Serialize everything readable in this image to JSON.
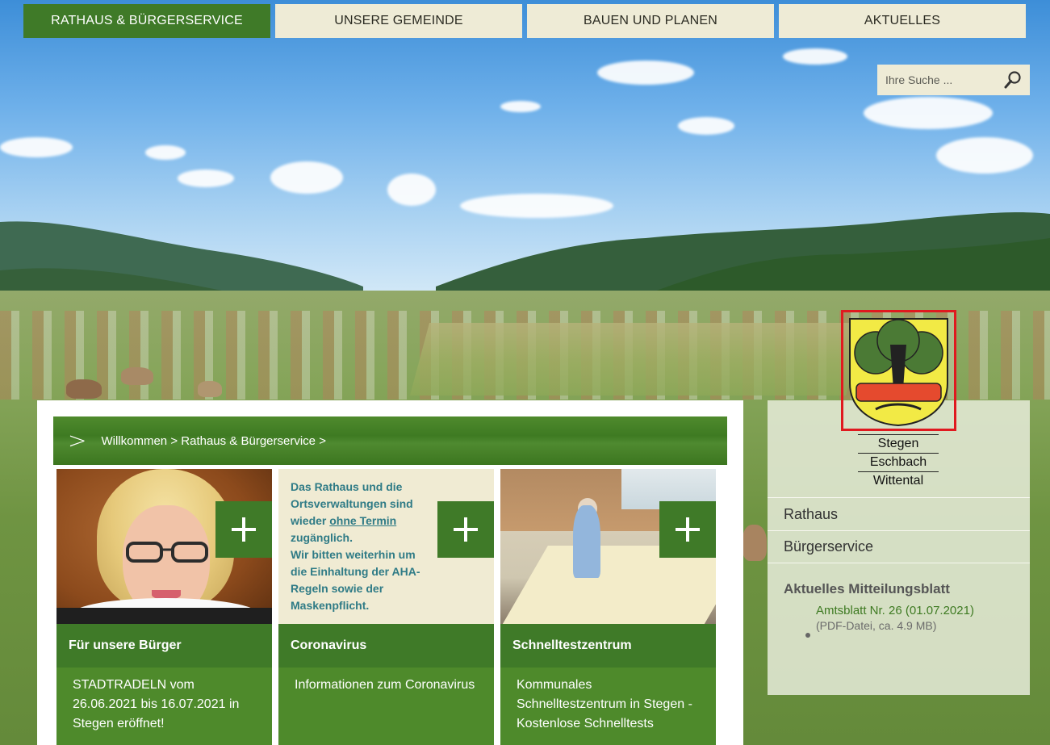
{
  "nav": {
    "items": [
      {
        "label": "RATHAUS & BÜRGERSERVICE",
        "active": true
      },
      {
        "label": "UNSERE GEMEINDE",
        "active": false
      },
      {
        "label": "BAUEN UND PLANEN",
        "active": false
      },
      {
        "label": "AKTUELLES",
        "active": false
      }
    ]
  },
  "search": {
    "placeholder": "Ihre Suche ...",
    "icon": "magnifier-icon"
  },
  "breadcrumb": {
    "icon": ">",
    "items": [
      "Willkommen",
      "Rathaus & Bürgerservice"
    ],
    "separator": ">"
  },
  "cards": [
    {
      "title": "Für unsere Bürger",
      "body": "STADTRADELN vom 26.06.2021 bis 16.07.2021 in Stegen eröffnet!",
      "plus": "+"
    },
    {
      "title": "Coronavirus",
      "body": "Informationen zum Coronavirus",
      "plus": "+",
      "teaser": {
        "line1": "Das Rathaus und die Ortsverwaltungen sind wieder ",
        "link": "ohne Termin",
        "line2": " zugänglich.",
        "line3": "Wir bitten weiterhin um die Einhaltung der AHA-Regeln sowie der Maskenpflicht."
      }
    },
    {
      "title": "Schnelltestzentrum",
      "body": "Kommunales Schnelltestzentrum in Stegen - Kostenlose Schnelltests",
      "plus": "+"
    }
  ],
  "sidebar": {
    "places": [
      "Stegen",
      "Eschbach",
      "Wittental"
    ],
    "links": [
      "Rathaus",
      "Bürgerservice"
    ],
    "mitteilung": {
      "heading": "Aktuelles Mitteilungsblatt",
      "doc_title": "Amtsblatt Nr. 26 (01.07.2021)",
      "doc_meta": "(PDF-Datei, ca. 4.9 MB)"
    }
  },
  "colors": {
    "brand_green": "#3f7a28",
    "nav_bg": "#eeebd6",
    "crest_frame": "#e0191f",
    "link_green": "#3e7a22"
  }
}
